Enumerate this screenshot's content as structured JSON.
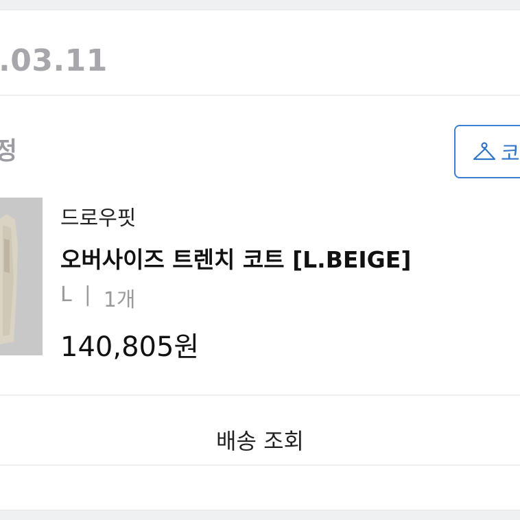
{
  "order": {
    "date": ".03.11",
    "status": "정",
    "outfit_button_label": "코",
    "track_button_label": "배송 조회"
  },
  "product": {
    "brand": "드로우핏",
    "name": "오버사이즈 트렌치 코트 [L.BEIGE]",
    "size": "L",
    "separator": "|",
    "quantity": "1개",
    "price": "140,805원"
  },
  "colors": {
    "accent": "#2f74c8",
    "background": "#eff0f2",
    "muted_text": "#9a9a9a"
  },
  "icons": {
    "outfit_button_icon": "hanger-icon"
  }
}
